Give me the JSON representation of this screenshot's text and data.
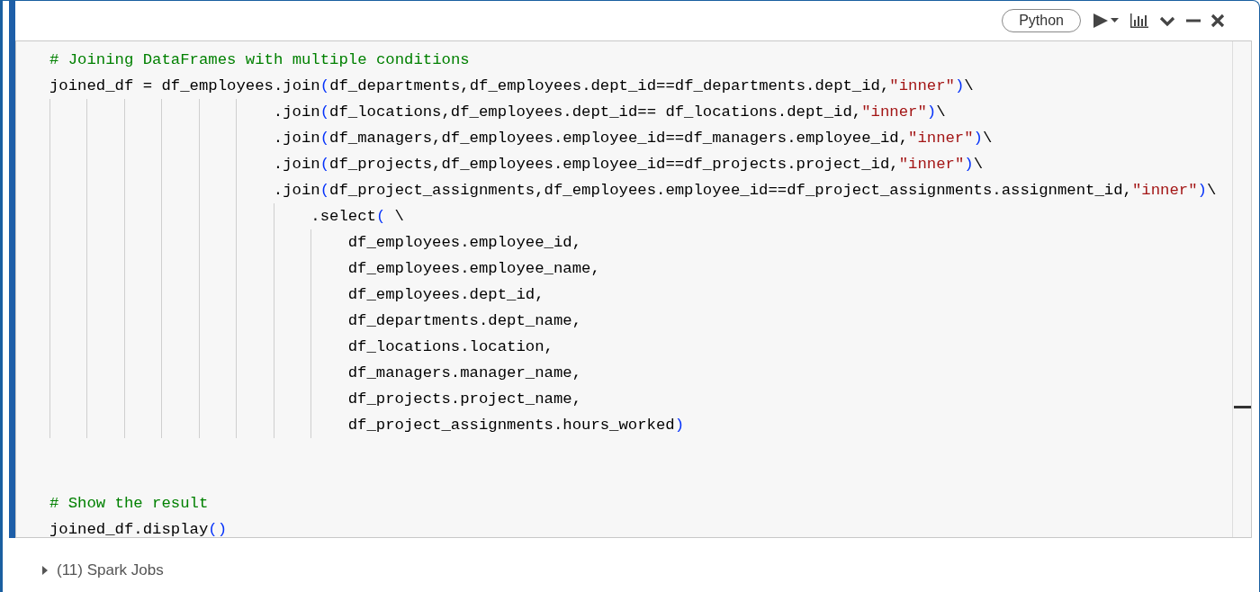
{
  "toolbar": {
    "language": "Python"
  },
  "code": {
    "lines": [
      {
        "kind": "code",
        "segments": [
          {
            "kind": "comment",
            "text": "# Joining DataFrames with multiple conditions"
          }
        ]
      },
      {
        "kind": "code",
        "segments": [
          {
            "kind": "plain",
            "text": "joined_df = df_employees.join"
          },
          {
            "kind": "bracket",
            "text": "("
          },
          {
            "kind": "plain",
            "text": "df_departments,df_employees.dept_id==df_departments.dept_id,"
          },
          {
            "kind": "string",
            "text": "\"inner\""
          },
          {
            "kind": "bracket",
            "text": ")"
          },
          {
            "kind": "plain",
            "text": "\\"
          }
        ]
      },
      {
        "kind": "code",
        "segments": [
          {
            "kind": "plain",
            "text": "                        .join"
          },
          {
            "kind": "bracket",
            "text": "("
          },
          {
            "kind": "plain",
            "text": "df_locations,df_employees.dept_id== df_locations.dept_id,"
          },
          {
            "kind": "string",
            "text": "\"inner\""
          },
          {
            "kind": "bracket",
            "text": ")"
          },
          {
            "kind": "plain",
            "text": "\\"
          }
        ]
      },
      {
        "kind": "code",
        "segments": [
          {
            "kind": "plain",
            "text": "                        .join"
          },
          {
            "kind": "bracket",
            "text": "("
          },
          {
            "kind": "plain",
            "text": "df_managers,df_employees.employee_id==df_managers.employee_id,"
          },
          {
            "kind": "string",
            "text": "\"inner\""
          },
          {
            "kind": "bracket",
            "text": ")"
          },
          {
            "kind": "plain",
            "text": "\\"
          }
        ]
      },
      {
        "kind": "code",
        "segments": [
          {
            "kind": "plain",
            "text": "                        .join"
          },
          {
            "kind": "bracket",
            "text": "("
          },
          {
            "kind": "plain",
            "text": "df_projects,df_employees.employee_id==df_projects.project_id,"
          },
          {
            "kind": "string",
            "text": "\"inner\""
          },
          {
            "kind": "bracket",
            "text": ")"
          },
          {
            "kind": "plain",
            "text": "\\"
          }
        ]
      },
      {
        "kind": "code",
        "segments": [
          {
            "kind": "plain",
            "text": "                        .join"
          },
          {
            "kind": "bracket",
            "text": "("
          },
          {
            "kind": "plain",
            "text": "df_project_assignments,df_employees.employee_id==df_project_assignments.assignment_id,"
          },
          {
            "kind": "string",
            "text": "\"inner\""
          },
          {
            "kind": "bracket",
            "text": ")"
          },
          {
            "kind": "plain",
            "text": "\\"
          }
        ]
      },
      {
        "kind": "code",
        "segments": [
          {
            "kind": "plain",
            "text": "                            .select"
          },
          {
            "kind": "bracket",
            "text": "("
          },
          {
            "kind": "plain",
            "text": " \\"
          }
        ]
      },
      {
        "kind": "code",
        "segments": [
          {
            "kind": "plain",
            "text": "                                df_employees.employee_id,"
          }
        ]
      },
      {
        "kind": "code",
        "segments": [
          {
            "kind": "plain",
            "text": "                                df_employees.employee_name,"
          }
        ]
      },
      {
        "kind": "code",
        "segments": [
          {
            "kind": "plain",
            "text": "                                df_employees.dept_id,"
          }
        ]
      },
      {
        "kind": "code",
        "segments": [
          {
            "kind": "plain",
            "text": "                                df_departments.dept_name,"
          }
        ]
      },
      {
        "kind": "code",
        "segments": [
          {
            "kind": "plain",
            "text": "                                df_locations.location,"
          }
        ]
      },
      {
        "kind": "code",
        "segments": [
          {
            "kind": "plain",
            "text": "                                df_managers.manager_name,"
          }
        ]
      },
      {
        "kind": "code",
        "segments": [
          {
            "kind": "plain",
            "text": "                                df_projects.project_name,"
          }
        ]
      },
      {
        "kind": "code",
        "segments": [
          {
            "kind": "plain",
            "text": "                                df_project_assignments.hours_worked"
          },
          {
            "kind": "bracket",
            "text": ")"
          }
        ]
      },
      {
        "kind": "blank"
      },
      {
        "kind": "blank"
      },
      {
        "kind": "code",
        "segments": [
          {
            "kind": "comment",
            "text": "# Show the result"
          }
        ]
      },
      {
        "kind": "code",
        "segments": [
          {
            "kind": "plain",
            "text": "joined_df.display"
          },
          {
            "kind": "bracket",
            "text": "()"
          }
        ]
      }
    ]
  },
  "output": {
    "label": "(11) Spark Jobs",
    "expanded": false
  }
}
